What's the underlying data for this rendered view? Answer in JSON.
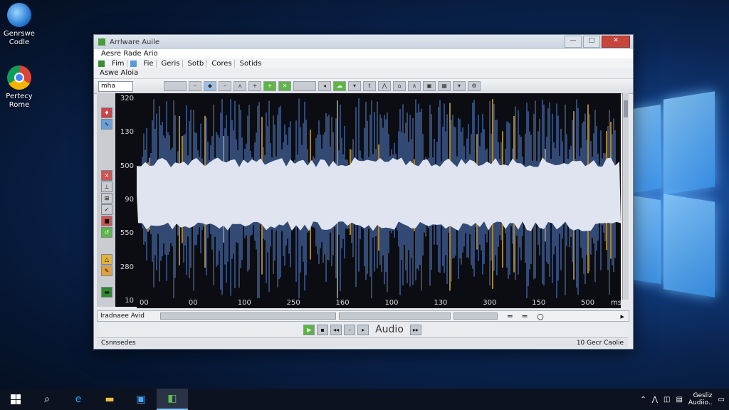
{
  "desktop": {
    "icons": [
      {
        "label_line1": "Genrswe",
        "label_line2": "Codle"
      },
      {
        "label_line1": "Pertecy",
        "label_line2": "Rome"
      }
    ]
  },
  "window": {
    "title": "Arrlware Auile",
    "app_name": "Aesre Rade Ario",
    "menu": [
      "Fim",
      "Fie",
      "Geris",
      "Sotb",
      "Cores",
      "Sotids"
    ],
    "sub_header": "Aswe Aloia",
    "format_field": "mha",
    "controls": {
      "min": "—",
      "max": "□",
      "close": "✕"
    }
  },
  "waveform": {
    "y_ticks": [
      "320",
      "130",
      "500",
      "90",
      "550",
      "280",
      "10"
    ],
    "x_ticks": [
      "00",
      "00",
      "100",
      "250",
      "160",
      "100",
      "130",
      "300",
      "150",
      "500"
    ],
    "x_unit": "ms",
    "colors": {
      "peak": "#3d5a8c",
      "body": "#dfe4f0",
      "accent": "#c9a04a",
      "bg": "#0b0d12"
    }
  },
  "track": {
    "name": "Iradnaee Avid"
  },
  "transport": {
    "label": "Audio"
  },
  "status": {
    "left": "Csnnsedes",
    "right": "10 Gecr Caolie"
  },
  "taskbar": {
    "clock_line1": "Gesliz",
    "clock_line2": "Audiio.."
  }
}
